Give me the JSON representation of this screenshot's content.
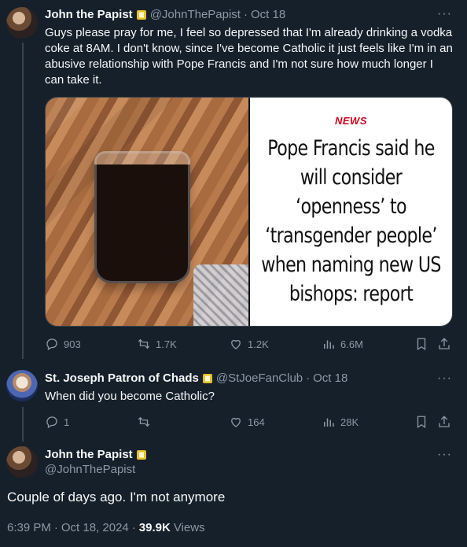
{
  "tweet1": {
    "author_name": "John the Papist",
    "author_handle": "@JohnThePapist",
    "date": "Oct 18",
    "text": "Guys please pray for me, I feel so depressed that I'm already drinking a vodka coke at 8AM. I don't know, since I've become Catholic it just feels like I'm in an abusive relationship with Pope Francis and I'm not sure how much longer I can take it.",
    "news_label": "NEWS",
    "news_headline": "Pope Francis said he will consider ‘openness’ to ‘transgender people’ when naming new US bishops: report",
    "actions": {
      "replies": "903",
      "retweets": "1.7K",
      "likes": "1.2K",
      "views": "6.6M"
    }
  },
  "tweet2": {
    "author_name": "St. Joseph Patron of Chads",
    "author_handle": "@StJoeFanClub",
    "date": "Oct 18",
    "text": "When did you become Catholic?",
    "actions": {
      "replies": "1",
      "retweets": "",
      "likes": "164",
      "views": "28K"
    }
  },
  "main_tweet": {
    "author_name": "John the Papist",
    "author_handle": "@JohnThePapist",
    "text": "Couple of days ago. I'm not anymore",
    "time": "6:39 PM",
    "date": "Oct 18, 2024",
    "views_count": "39.9K",
    "views_label": "Views"
  },
  "separator": "·",
  "more_glyph": "···",
  "colors": {
    "background": "#15202b",
    "muted": "#8b98a5",
    "badge": "#e6c229",
    "news_red": "#d0021b"
  }
}
